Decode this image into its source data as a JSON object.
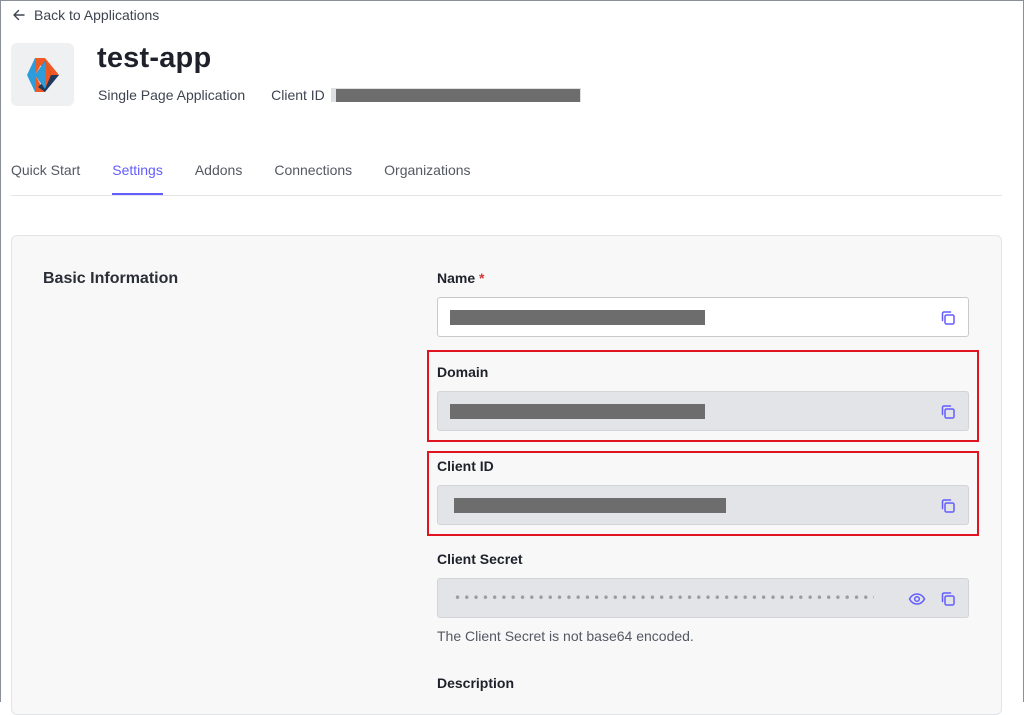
{
  "nav": {
    "back_label": "Back to Applications"
  },
  "app": {
    "name": "test-app",
    "type": "Single Page Application",
    "client_id_label": "Client ID"
  },
  "tabs": [
    {
      "label": "Quick Start",
      "active": false
    },
    {
      "label": "Settings",
      "active": true
    },
    {
      "label": "Addons",
      "active": false
    },
    {
      "label": "Connections",
      "active": false
    },
    {
      "label": "Organizations",
      "active": false
    }
  ],
  "section": {
    "title": "Basic Information"
  },
  "fields": {
    "name": {
      "label": "Name",
      "required_mark": "*"
    },
    "domain": {
      "label": "Domain"
    },
    "client_id": {
      "label": "Client ID"
    },
    "client_secret": {
      "label": "Client Secret",
      "masked_value": "••••••••••••••••••••••••••••••••••••••••••••••••",
      "hint": "The Client Secret is not base64 encoded."
    },
    "description": {
      "label": "Description"
    }
  },
  "colors": {
    "accent": "#635dff",
    "highlight": "#e0141e"
  }
}
